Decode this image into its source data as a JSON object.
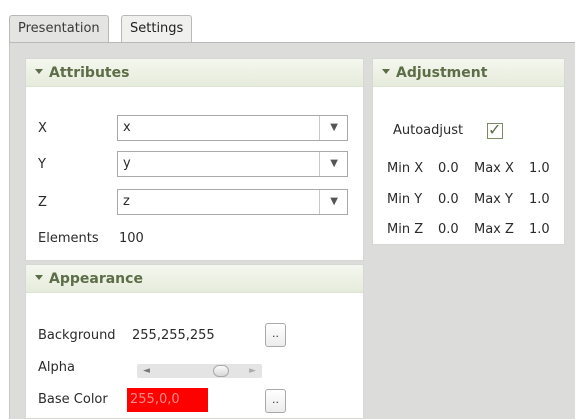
{
  "tabs": {
    "presentation": "Presentation",
    "settings": "Settings"
  },
  "attributes": {
    "title": "Attributes",
    "x_label": "X",
    "x_value": "x",
    "y_label": "Y",
    "y_value": "y",
    "z_label": "Z",
    "z_value": "z",
    "elements_label": "Elements",
    "elements_value": "100"
  },
  "appearance": {
    "title": "Appearance",
    "background_label": "Background",
    "background_value": "255,255,255",
    "alpha_label": "Alpha",
    "alpha_level": 0.75,
    "base_color_label": "Base Color",
    "base_color_value": "255,0,0",
    "base_color_hex": "#ff0000",
    "button_label": ".."
  },
  "adjustment": {
    "title": "Adjustment",
    "autoadjust_label": "Autoadjust",
    "autoadjust_checked": true,
    "min_x_label": "Min X",
    "min_x": "0.0",
    "max_x_label": "Max X",
    "max_x": "1.0",
    "min_y_label": "Min Y",
    "min_y": "0.0",
    "max_y_label": "Max Y",
    "max_y": "1.0",
    "min_z_label": "Min Z",
    "min_z": "0.0",
    "max_z_label": "Max Z",
    "max_z": "1.0"
  },
  "icons": {
    "dropdown": "chevron-down-icon",
    "check": "checkmark-icon",
    "collapse": "caret-down-icon"
  },
  "colors": {
    "panel_title": "#5d6d47",
    "background": "#dcdcda"
  }
}
